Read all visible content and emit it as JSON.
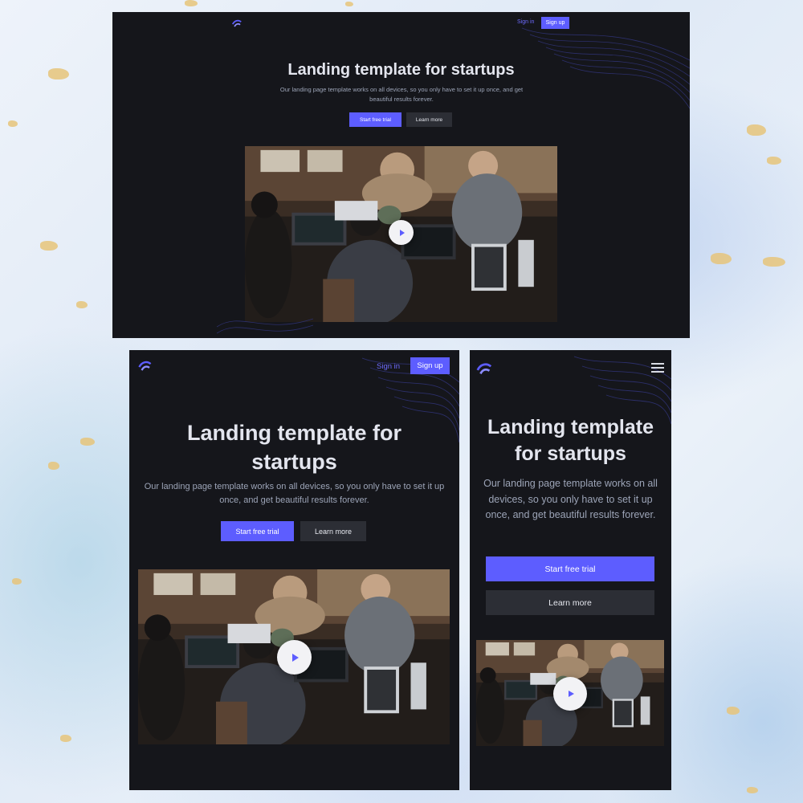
{
  "brand": {
    "accent": "#5d5dff",
    "background": "#15161b",
    "logo_icon": "brand-logo-icon"
  },
  "header": {
    "signin_label": "Sign in",
    "signup_label": "Sign up",
    "menu_icon": "hamburger-icon"
  },
  "hero": {
    "title": "Landing template for startups",
    "subtitle": "Our landing page template works on all devices, so you only have to set it up once, and get beautiful results forever.",
    "primary_cta": "Start free trial",
    "secondary_cta": "Learn more"
  },
  "media": {
    "play_icon": "play-icon",
    "image_icon": "team-photo"
  }
}
